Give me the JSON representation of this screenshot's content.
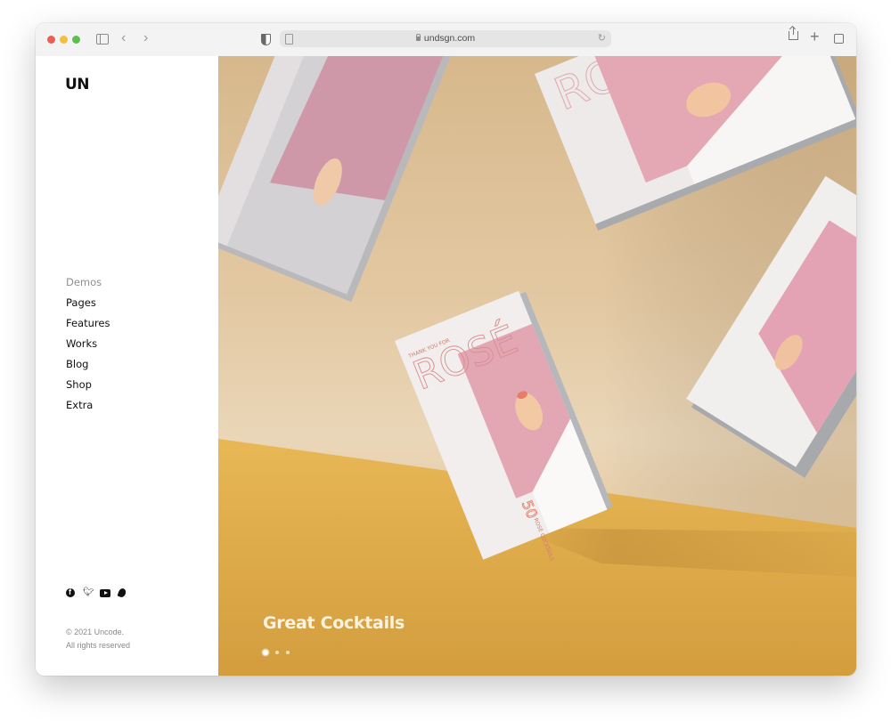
{
  "browser": {
    "url": "undsgn.com",
    "icons": [
      "sidebar-toggle-icon",
      "back-icon",
      "forward-icon",
      "shield-icon",
      "page-icon",
      "lock-icon",
      "reload-icon",
      "share-icon",
      "new-tab-icon",
      "tabs-overview-icon"
    ]
  },
  "sidebar": {
    "logo": "UN",
    "menu": [
      {
        "label": "Demos",
        "active": false
      },
      {
        "label": "Pages"
      },
      {
        "label": "Features"
      },
      {
        "label": "Works"
      },
      {
        "label": "Blog"
      },
      {
        "label": "Shop"
      },
      {
        "label": "Extra"
      }
    ],
    "social": [
      "facebook-icon",
      "twitter-icon",
      "youtube-icon",
      "dribbble-icon"
    ],
    "copyright_line1": "© 2021 Uncode.",
    "copyright_line2": "All rights reserved"
  },
  "hero": {
    "title": "Great Cocktails",
    "slides_total": 3,
    "current_slide": 1,
    "book": {
      "kicker": "THANK YOU FOR",
      "title": "ROSÉ",
      "number": "50",
      "subtitle": "ROSÉ COCKTAILS"
    },
    "colors": {
      "wall": "#e3c9a3",
      "floor": "#deaa4a",
      "book_pink": "#e5a8b6",
      "book_white": "#f4f1f0",
      "title_text": "#fbf3df"
    }
  }
}
